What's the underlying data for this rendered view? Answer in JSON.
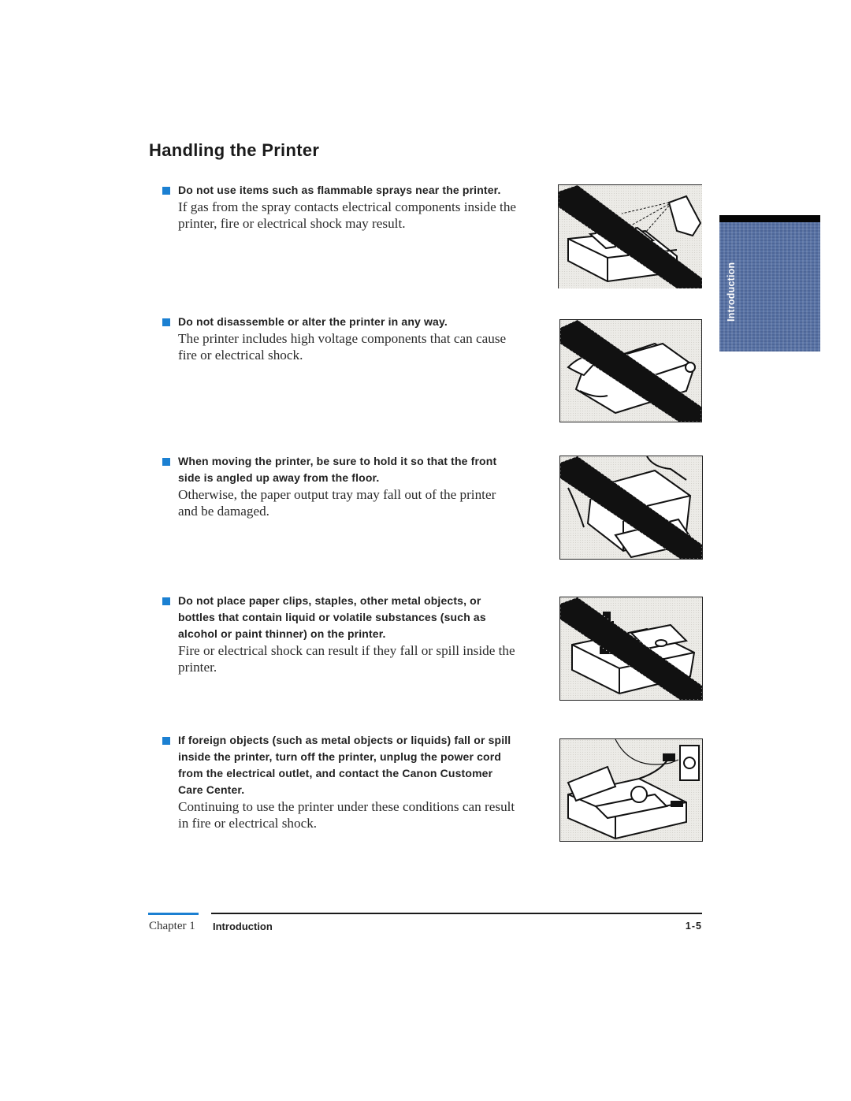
{
  "page": {
    "title": "Handling the Printer"
  },
  "side_tab": {
    "label": "Introduction",
    "color": "#5a74a6"
  },
  "accent_color": "#1b80d2",
  "items": [
    {
      "heading": "Do not use items such as flammable sprays near the printer.",
      "body": "If gas from the spray contacts electrical components inside the printer, fire or electrical shock may result.",
      "illustration": "flammable-spray-prohibited-illustration"
    },
    {
      "heading": "Do not disassemble or alter the printer in any way.",
      "body": "The printer includes high voltage components that can cause fire or electrical shock.",
      "illustration": "disassembly-prohibited-illustration"
    },
    {
      "heading": "When moving the printer, be sure to hold it so that the front side is angled up away from the floor.",
      "body": "Otherwise, the paper output tray may fall out of the printer and be damaged.",
      "illustration": "moving-printer-illustration"
    },
    {
      "heading": "Do not place paper clips, staples, other metal objects, or bottles that contain liquid or volatile substances (such as alcohol or paint thinner) on the printer.",
      "body": "Fire or electrical shock can result if they fall or spill inside the printer.",
      "illustration": "objects-on-printer-prohibited-illustration"
    },
    {
      "heading": "If foreign objects (such as metal objects or liquids) fall or spill inside the printer, turn off the printer, unplug the power cord from the electrical outlet, and contact the Canon Customer Care Center.",
      "body": "Continuing to use the printer under these conditions can result in fire or electrical shock.",
      "illustration": "unplug-power-cord-illustration"
    }
  ],
  "footer": {
    "chapter": "Chapter 1",
    "section": "Introduction",
    "page_number": "1-5"
  }
}
